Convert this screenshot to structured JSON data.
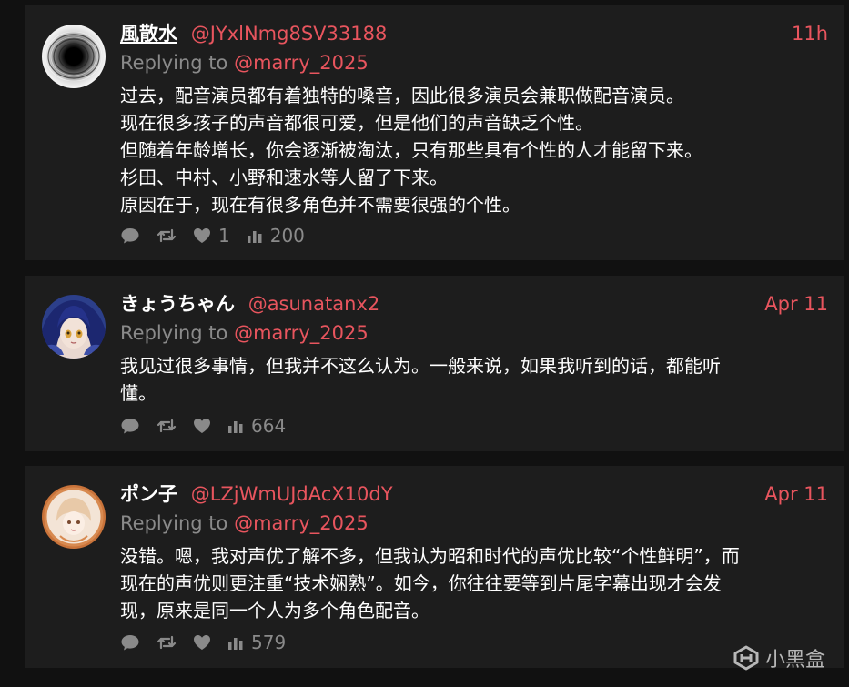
{
  "tweets": [
    {
      "name": "風散水",
      "handle": "@JYxlNmg8SV33188",
      "time": "11h",
      "replying_prefix": "Replying to",
      "replying_handle": "@marry_2025",
      "body_lines": [
        "过去，配音演员都有着独特的嗓音，因此很多演员会兼职做配音演员。",
        "现在很多孩子的声音都很可爱，但是他们的声音缺乏个性。",
        "但随着年龄增长，你会逐渐被淘汰，只有那些具有个性的人才能留下来。",
        "杉田、中村、小野和速水等人留了下来。",
        "原因在于，现在有很多角色并不需要很强的个性。"
      ],
      "stats": {
        "replies": "",
        "retweets": "",
        "likes": "1",
        "views": "200"
      }
    },
    {
      "name": "きょうちゃん",
      "handle": "@asunatanx2",
      "time": "Apr 11",
      "replying_prefix": "Replying to",
      "replying_handle": "@marry_2025",
      "body_lines": [
        "我见过很多事情，但我并不这么认为。一般来说，如果我听到的话，都能听",
        "懂。"
      ],
      "stats": {
        "replies": "",
        "retweets": "",
        "likes": "",
        "views": "664"
      }
    },
    {
      "name": "ポン子",
      "handle": "@LZjWmUJdAcX10dY",
      "time": "Apr 11",
      "replying_prefix": "Replying to",
      "replying_handle": "@marry_2025",
      "body_lines": [
        "没错。嗯，我对声优了解不多，但我认为昭和时代的声优比较“个性鲜明”，而",
        "现在的声优则更注重“技术娴熟”。如今，你往往要等到片尾字幕出现才会发",
        "现，原来是同一个人为多个角色配音。"
      ],
      "stats": {
        "replies": "",
        "retweets": "",
        "likes": "",
        "views": "579"
      }
    }
  ],
  "watermark": {
    "text": "小黑盒",
    "icon": "xiaoheihe-logo-icon"
  },
  "colors": {
    "background": "#111111",
    "card": "#1d1d1d",
    "accent": "#e8555e",
    "muted": "#8a8a8a",
    "text": "#ffffff"
  }
}
